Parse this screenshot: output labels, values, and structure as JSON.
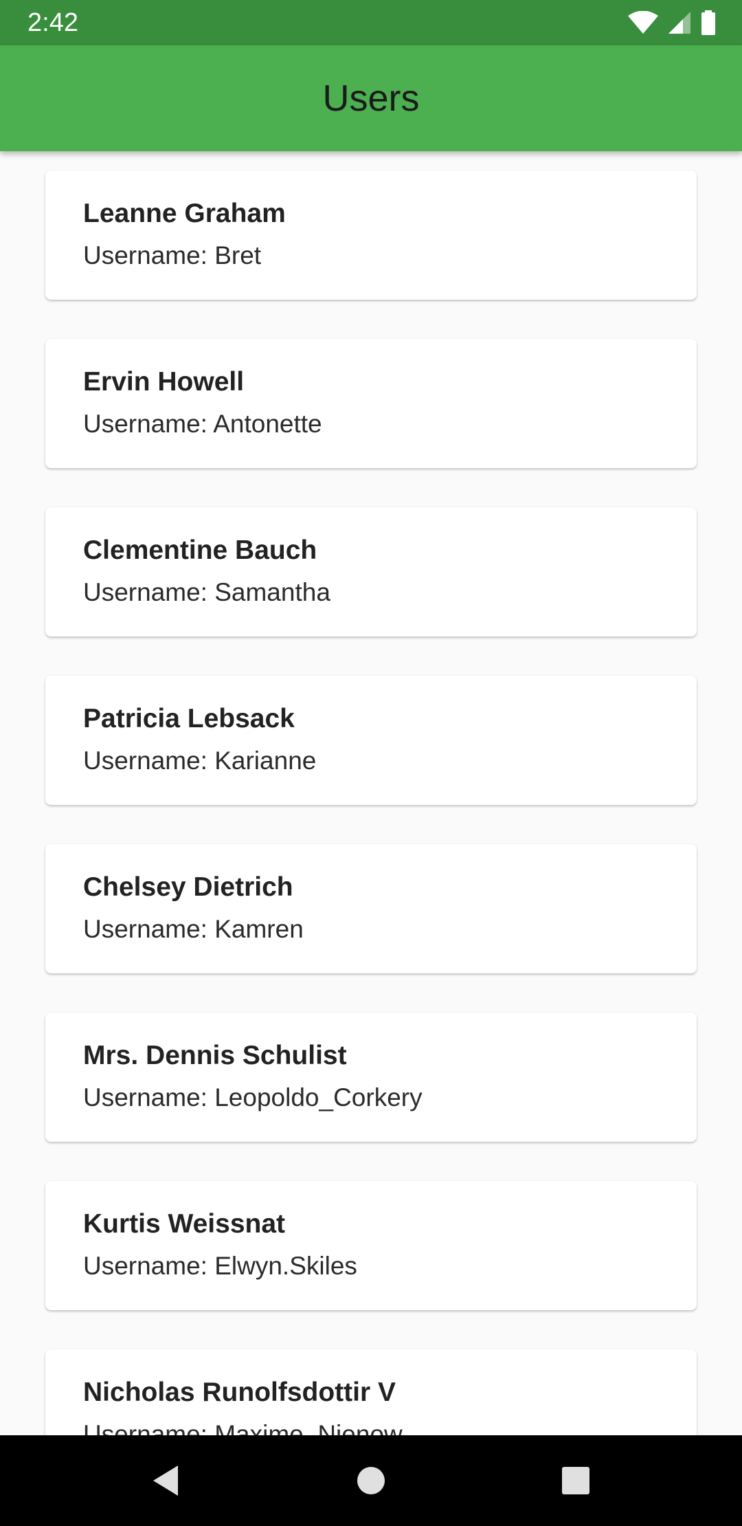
{
  "status_bar": {
    "time": "2:42",
    "icons": [
      "wifi-icon",
      "signal-icon",
      "battery-icon"
    ]
  },
  "app_bar": {
    "title": "Users",
    "color": "#4caf50"
  },
  "users": [
    {
      "name": "Leanne Graham",
      "username_prefix": "Username: ",
      "username": "Bret"
    },
    {
      "name": "Ervin Howell",
      "username_prefix": "Username: ",
      "username": "Antonette"
    },
    {
      "name": "Clementine Bauch",
      "username_prefix": "Username: ",
      "username": "Samantha"
    },
    {
      "name": "Patricia Lebsack",
      "username_prefix": "Username: ",
      "username": "Karianne"
    },
    {
      "name": "Chelsey Dietrich",
      "username_prefix": "Username: ",
      "username": "Kamren"
    },
    {
      "name": "Mrs. Dennis Schulist",
      "username_prefix": "Username: ",
      "username": "Leopoldo_Corkery"
    },
    {
      "name": "Kurtis Weissnat",
      "username_prefix": "Username: ",
      "username": "Elwyn.Skiles"
    },
    {
      "name": "Nicholas Runolfsdottir V",
      "username_prefix": "Username: ",
      "username": "Maxime_Nienow"
    }
  ],
  "nav_bar": {
    "buttons": [
      "back-icon",
      "home-icon",
      "recents-icon"
    ]
  }
}
